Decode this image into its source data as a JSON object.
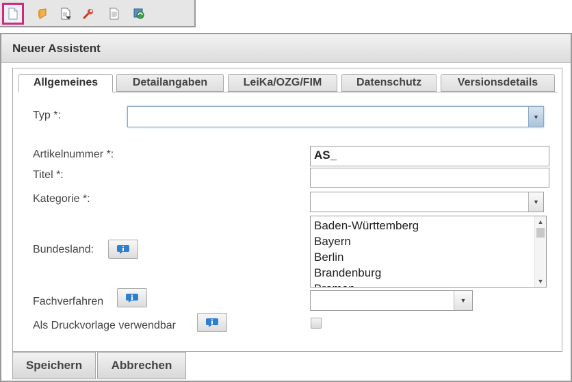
{
  "toolbar": {
    "buttons": [
      {
        "name": "new-document-icon"
      },
      {
        "name": "shield-icon"
      },
      {
        "name": "import-document-icon"
      },
      {
        "name": "wrench-icon"
      },
      {
        "name": "text-document-icon"
      },
      {
        "name": "refresh-globe-icon"
      }
    ]
  },
  "dialog": {
    "title": "Neuer Assistent",
    "tabs": [
      "Allgemeines",
      "Detailangaben",
      "LeiKa/OZG/FIM",
      "Datenschutz",
      "Versionsdetails"
    ],
    "active_tab": "Allgemeines",
    "fields": {
      "typ": {
        "label": "Typ *:",
        "value": ""
      },
      "artikelnummer": {
        "label": "Artikelnummer *:",
        "value": "AS_"
      },
      "titel": {
        "label": "Titel *:",
        "value": ""
      },
      "kategorie": {
        "label": "Kategorie *:",
        "value": ""
      },
      "bundesland": {
        "label": "Bundesland:",
        "options": [
          "Baden-Württemberg",
          "Bayern",
          "Berlin",
          "Brandenburg",
          "Bremen"
        ]
      },
      "fachverfahren": {
        "label": "Fachverfahren",
        "value": ""
      },
      "druckvorlage": {
        "label": "Als Druckvorlage verwendbar",
        "checked": false
      }
    },
    "buttons": {
      "save": "Speichern",
      "cancel": "Abbrechen"
    }
  },
  "colors": {
    "active_toolbar_outline": "#d0287a",
    "info_icon": "#2f7fd0"
  }
}
